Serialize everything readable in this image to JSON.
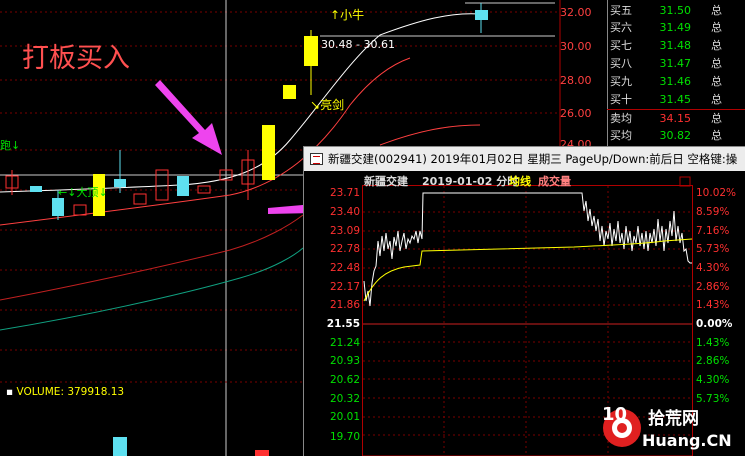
{
  "annotations": {
    "buy_text": "打板买入",
    "xiaoniu": "小牛",
    "liangjian": "亮剑",
    "dadingjian": "大顶",
    "pao": "跑",
    "price_range": "30.48 - 30.61",
    "volume_label": "VOLUME: 379918.13"
  },
  "right_axis": [
    "32.00",
    "30.00",
    "28.00",
    "26.00",
    "24.00"
  ],
  "order_book": [
    {
      "label": "买五",
      "price": "31.50",
      "vol": "总"
    },
    {
      "label": "买六",
      "price": "31.49",
      "vol": "总"
    },
    {
      "label": "买七",
      "price": "31.48",
      "vol": "总"
    },
    {
      "label": "买八",
      "price": "31.47",
      "vol": "总"
    },
    {
      "label": "买九",
      "price": "31.46",
      "vol": "总"
    },
    {
      "label": "买十",
      "price": "31.45",
      "vol": "总"
    },
    {
      "label": "卖均",
      "price": "34.15",
      "vol": "总"
    },
    {
      "label": "买均",
      "price": "30.82",
      "vol": "总"
    }
  ],
  "popup": {
    "title": "新疆交建(002941) 2019年01月02日 星期三 PageUp/Down:前后日 空格键:操",
    "stock_name": "新疆交建",
    "date_label": "2019-01-02 分时",
    "avg_label": "均线",
    "vol_label": "成交量",
    "left_axis": [
      "23.71",
      "23.40",
      "23.09",
      "22.78",
      "22.48",
      "22.17",
      "21.86",
      "21.55",
      "21.24",
      "20.93",
      "20.62",
      "20.32",
      "20.01",
      "19.70"
    ],
    "right_axis": [
      "10.02%",
      "8.59%",
      "7.16%",
      "5.73%",
      "4.30%",
      "2.86%",
      "1.43%",
      "0.00%",
      "1.43%",
      "2.86%",
      "4.30%",
      "5.73%"
    ],
    "close_price": "21.55"
  },
  "logo": {
    "num": "10",
    "cn": "拾荒网",
    "en": "Huang.CN"
  },
  "colors": {
    "up": "#ff3030",
    "down": "#00e000",
    "yellow": "#ffff00",
    "cyan": "#5ee0f0",
    "magenta": "#e040e0",
    "background": "#000000"
  }
}
